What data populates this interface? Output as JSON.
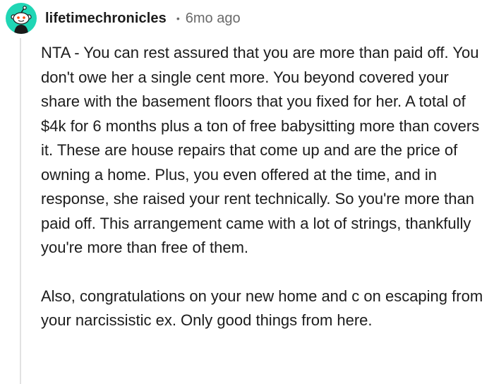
{
  "comment": {
    "username": "lifetimechronicles",
    "separator": "•",
    "timestamp": "6mo ago",
    "avatar_icon": "reddit-snoo-avatar-icon",
    "avatar_color": "#20d6b5",
    "paragraphs": [
      "NTA - You can rest assured that you are more than paid off. You don't owe her a single cent more. You beyond covered your share with the basement floors that you fixed for her. A total of $4k for 6 months plus a ton of free babysitting more than covers it. These are house repairs that come up and are the price of owning a home. Plus, you even offered at the time, and in response, she raised your rent technically. So you're more than paid off. This arrangement came with a lot of strings, thankfully you're more than free of them.",
      "Also, congratulations on your new home and c on escaping from your narcissistic ex. Only good things from here."
    ]
  }
}
